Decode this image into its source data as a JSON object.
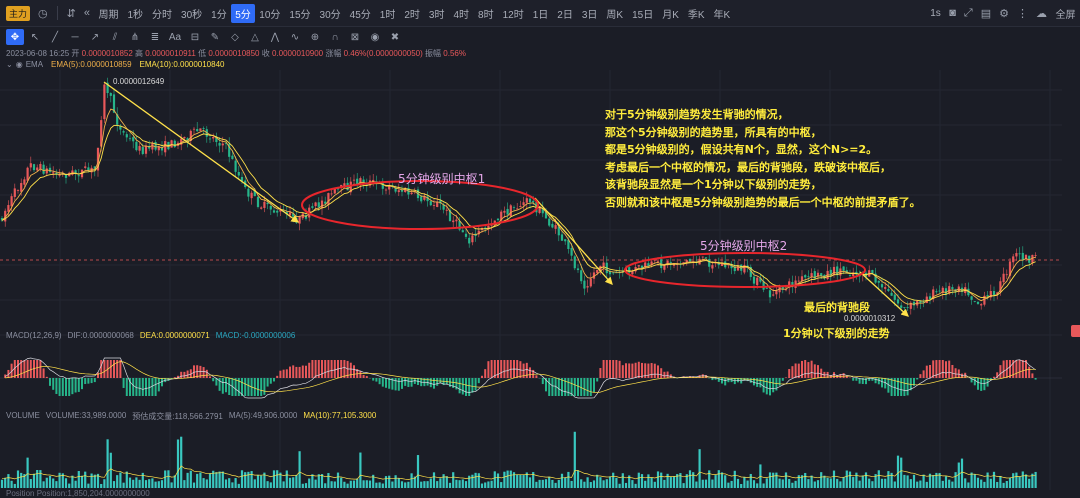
{
  "toolbar": {
    "main_badge": "主力",
    "period_label": "周期",
    "timeframes": [
      "1秒",
      "分时",
      "30秒",
      "1分",
      "5分",
      "10分",
      "15分",
      "30分",
      "45分",
      "1时",
      "2时",
      "3时",
      "4时",
      "8时",
      "12时",
      "1日",
      "2日",
      "3日",
      "周K",
      "15日",
      "月K",
      "季K",
      "年K"
    ],
    "active_timeframe": "5分",
    "right_interval": "1s",
    "fullscreen_label": "全屏"
  },
  "info_line": {
    "datetime": "2023-06-08 16:25",
    "open_label": "开",
    "open": "0.0000010852",
    "high_label": "高",
    "high": "0.0000010911",
    "low_label": "低",
    "low": "0.0000010850",
    "close_label": "收",
    "close": "0.0000010900",
    "change_label": "涨幅",
    "change": "0.46%(0.0000000050)",
    "amplitude_label": "振幅",
    "amplitude": "0.56%"
  },
  "ema": {
    "label": "EMA",
    "ema5": "EMA(5):0.0000010859",
    "ema10": "EMA(10):0.0000010840"
  },
  "price_labels": {
    "high": "0.0000012649",
    "low": "0.0000010312"
  },
  "macd": {
    "label": "MACD(12,26,9)",
    "dif": "DIF:0.0000000068",
    "dea": "DEA:0.0000000071",
    "macd": "MACD:-0.0000000006"
  },
  "volume": {
    "label": "VOLUME",
    "vol": "VOLUME:33,989.0000",
    "estimate": "预估成交量:118,566.2791",
    "ma5": "MA(5):49,906.0000",
    "ma10": "MA(10):77,105.3000"
  },
  "position": {
    "label": "Position",
    "value": "Position:1,850,204.0000000000"
  },
  "annotations": {
    "block": [
      "对于5分钟级别趋势发生背驰的情况，",
      "那这个5分钟级别的趋势里，所具有的中枢，",
      "都是5分钟级别的，假设共有N个，显然，这个N>=2。",
      "考虑最后一个中枢的情况，最后的背驰段，跌破该中枢后，",
      "该背驰段显然是一个1分钟以下级别的走势，",
      "否则就和该中枢是5分钟级别趋势的最后一个中枢的前提矛盾了。"
    ],
    "zhongshu1": "5分钟级别中枢1",
    "zhongshu2": "5分钟级别中枢2",
    "last_divergence": "最后的背驰段",
    "one_min_trend": "1分钟以下级别的走势"
  },
  "colors": {
    "up": "#e8585a",
    "down": "#26b58a",
    "arrow": "#ffe14a",
    "ellipse": "#e8262c",
    "ema5": "#f0b04a",
    "ema10": "#ffe04a",
    "dea": "#ffe04a",
    "volume": "#39c8c0"
  }
}
